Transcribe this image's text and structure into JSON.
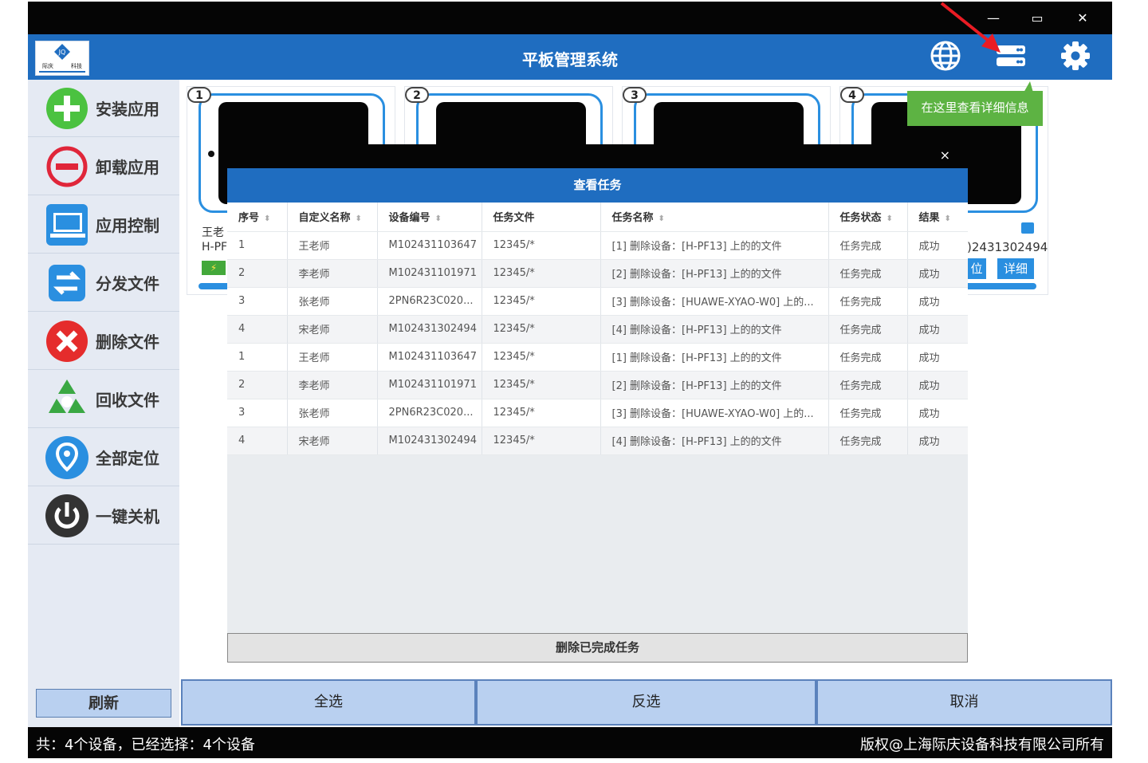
{
  "app": {
    "title": "平板管理系统",
    "window_controls": {
      "minimize": "—",
      "maximize": "▭",
      "close": "✕"
    }
  },
  "header_icons": [
    "globe-icon",
    "server-list-icon",
    "gear-icon"
  ],
  "tooltip": "在这里查看详细信息",
  "sidebar": {
    "items": [
      {
        "label": "安装应用",
        "icon": "install-plus-icon",
        "color": "#4bc240"
      },
      {
        "label": "卸载应用",
        "icon": "uninstall-minus-icon",
        "color": "#e0263a"
      },
      {
        "label": "应用控制",
        "icon": "app-control-icon",
        "color": "#2a8fe0"
      },
      {
        "label": "分发文件",
        "icon": "distribute-file-icon",
        "color": "#2a8fe0"
      },
      {
        "label": "删除文件",
        "icon": "delete-file-icon",
        "color": "#e52c2c"
      },
      {
        "label": "回收文件",
        "icon": "recycle-icon",
        "color": "#3aa843"
      },
      {
        "label": "全部定位",
        "icon": "location-pin-icon",
        "color": "#2a8fe0"
      },
      {
        "label": "一键关机",
        "icon": "power-icon",
        "color": "#333333"
      }
    ],
    "refresh_label": "刷新"
  },
  "devices": [
    {
      "num": "1",
      "name_partial": "王老",
      "model_partial": "H-PF"
    },
    {
      "num": "2"
    },
    {
      "num": "3"
    },
    {
      "num": "4",
      "serial_partial": ")2431302494",
      "locate_partial": "位",
      "detail_label": "详细"
    }
  ],
  "modal": {
    "close": "×",
    "title": "查看任务",
    "columns": [
      "序号",
      "自定义名称",
      "设备编号",
      "任务文件",
      "任务名称",
      "任务状态",
      "结果"
    ],
    "rows": [
      [
        "1",
        "王老师",
        "M102431103647",
        "12345/*",
        "[1] 删除设备：[H-PF13] 上的的文件",
        "任务完成",
        "成功"
      ],
      [
        "2",
        "李老师",
        "M102431101971",
        "12345/*",
        "[2] 删除设备：[H-PF13] 上的的文件",
        "任务完成",
        "成功"
      ],
      [
        "3",
        "张老师",
        "2PN6R23C020...",
        "12345/*",
        "[3] 删除设备：[HUAWE-XYAO-W0] 上的...",
        "任务完成",
        "成功"
      ],
      [
        "4",
        "宋老师",
        "M102431302494",
        "12345/*",
        "[4] 删除设备：[H-PF13] 上的的文件",
        "任务完成",
        "成功"
      ],
      [
        "1",
        "王老师",
        "M102431103647",
        "12345/*",
        "[1] 删除设备：[H-PF13] 上的的文件",
        "任务完成",
        "成功"
      ],
      [
        "2",
        "李老师",
        "M102431101971",
        "12345/*",
        "[2] 删除设备：[H-PF13] 上的的文件",
        "任务完成",
        "成功"
      ],
      [
        "3",
        "张老师",
        "2PN6R23C020...",
        "12345/*",
        "[3] 删除设备：[HUAWE-XYAO-W0] 上的...",
        "任务完成",
        "成功"
      ],
      [
        "4",
        "宋老师",
        "M102431302494",
        "12345/*",
        "[4] 删除设备：[H-PF13] 上的的文件",
        "任务完成",
        "成功"
      ]
    ],
    "delete_done_label": "删除已完成任务"
  },
  "bottom_buttons": {
    "select_all": "全选",
    "invert": "反选",
    "cancel": "取消"
  },
  "status": {
    "left": "共：4个设备，已经选择：4个设备",
    "right": "版权@上海际庆设备科技有限公司所有"
  },
  "colors": {
    "brand_blue": "#1f6dc0",
    "tooltip_green": "#5db343",
    "button_blue": "#b9d0f0"
  }
}
